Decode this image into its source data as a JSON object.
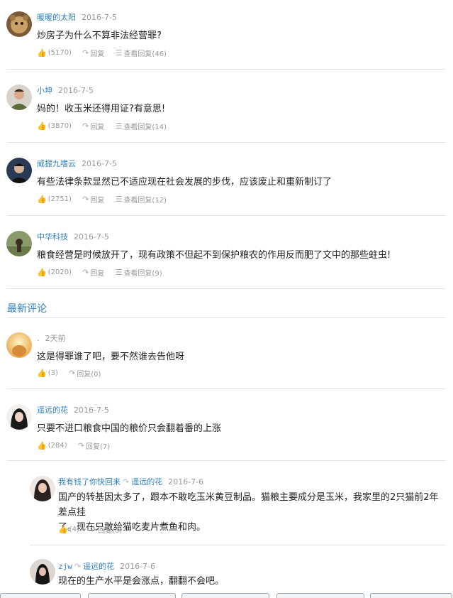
{
  "comments": [
    {
      "user": "暖暖的太阳",
      "date": "2016-7-5",
      "text": "炒房子为什么不算非法经营罪?",
      "likes": "(5170)",
      "reply": "回复",
      "view_replies": "查看回复(46)"
    },
    {
      "user": "小坤",
      "date": "2016-7-5",
      "text": "妈的！收玉米还得用证?有意思!",
      "likes": "(3870)",
      "reply": "回复",
      "view_replies": "查看回复(14)"
    },
    {
      "user": "威振九嗜云",
      "date": "2016-7-5",
      "text": "有些法律条款显然已不适应现在社会发展的步伐，应该废止和重新制订了",
      "likes": "(2751)",
      "reply": "回复",
      "view_replies": "查看回复(12)"
    },
    {
      "user": "中华科技",
      "date": "2016-7-5",
      "text": "粮食经营是时候放开了，现有政策不但起不到保护粮农的作用反而肥了文中的那些蛀虫!",
      "likes": "(2020)",
      "reply": "回复",
      "view_replies": "查看回复(9)"
    }
  ],
  "latest_title": "最新评论",
  "latest": [
    {
      "user": ".",
      "date": "2天前",
      "text": "这是得罪谁了吧，要不然谁去告他呀",
      "likes": "(3)",
      "reply": "回复(0)"
    },
    {
      "user": "遥远的花",
      "date": "2016-7-5",
      "text": "只要不进口粮食中国的粮价只会翻着番的上涨",
      "likes": "(284)",
      "reply": "回复(7)"
    }
  ],
  "replies": [
    {
      "user": "我有钱了你快回来",
      "reply_to": "遥远的花",
      "date": "2016-7-6",
      "text_line1": "国产的转基因太多了，跟本不敢吃玉米黄豆制品。猫粮主要成分是玉米，我家里的2只猫前2年差点挂",
      "text_line2": "了。现在只敢给猫吃麦片煮鱼和肉。",
      "likes": "(4)",
      "reply": "回复(0)"
    },
    {
      "user": "zjw",
      "reply_to": "遥远的花",
      "date": "2016-7-6",
      "text": "现在的生产水平是会涨点，翻翻不会吧。"
    }
  ]
}
